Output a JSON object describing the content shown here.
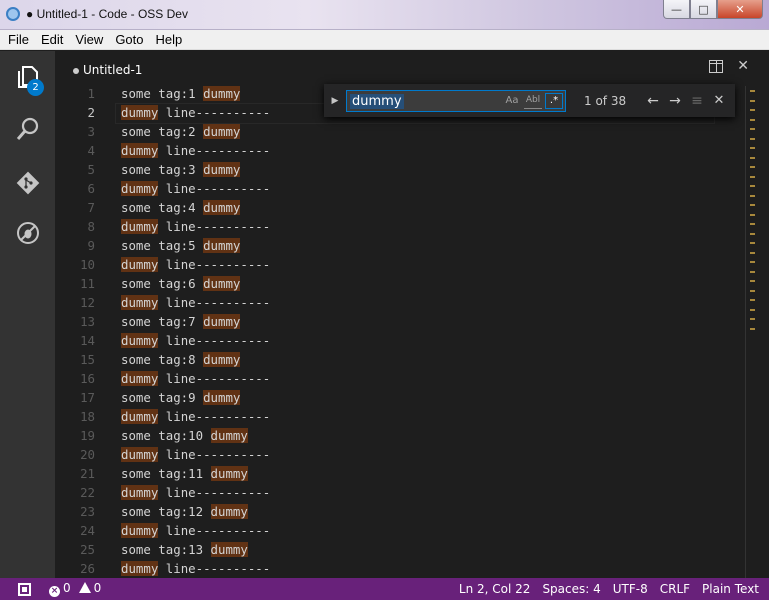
{
  "window": {
    "title": "● Untitled-1 - Code - OSS Dev"
  },
  "menu": [
    "File",
    "Edit",
    "View",
    "Goto",
    "Help"
  ],
  "activity": {
    "explorer_badge": "2"
  },
  "tab": {
    "title": "Untitled-1"
  },
  "find": {
    "query": "dummy",
    "match_case_label": "Aa",
    "whole_word_label": "Abl",
    "regex_label": ".*",
    "count": "1 of 38"
  },
  "lines": [
    {
      "n": "1",
      "pre": "some tag:1 ",
      "hl": "dummy",
      "post": ""
    },
    {
      "n": "2",
      "pre": "",
      "hl": "dummy",
      "post": " line----------"
    },
    {
      "n": "3",
      "pre": "some tag:2 ",
      "hl": "dummy",
      "post": ""
    },
    {
      "n": "4",
      "pre": "",
      "hl": "dummy",
      "post": " line----------"
    },
    {
      "n": "5",
      "pre": "some tag:3 ",
      "hl": "dummy",
      "post": ""
    },
    {
      "n": "6",
      "pre": "",
      "hl": "dummy",
      "post": " line----------"
    },
    {
      "n": "7",
      "pre": "some tag:4 ",
      "hl": "dummy",
      "post": ""
    },
    {
      "n": "8",
      "pre": "",
      "hl": "dummy",
      "post": " line----------"
    },
    {
      "n": "9",
      "pre": "some tag:5 ",
      "hl": "dummy",
      "post": ""
    },
    {
      "n": "10",
      "pre": "",
      "hl": "dummy",
      "post": " line----------"
    },
    {
      "n": "11",
      "pre": "some tag:6 ",
      "hl": "dummy",
      "post": ""
    },
    {
      "n": "12",
      "pre": "",
      "hl": "dummy",
      "post": " line----------"
    },
    {
      "n": "13",
      "pre": "some tag:7 ",
      "hl": "dummy",
      "post": ""
    },
    {
      "n": "14",
      "pre": "",
      "hl": "dummy",
      "post": " line----------"
    },
    {
      "n": "15",
      "pre": "some tag:8 ",
      "hl": "dummy",
      "post": ""
    },
    {
      "n": "16",
      "pre": "",
      "hl": "dummy",
      "post": " line----------"
    },
    {
      "n": "17",
      "pre": "some tag:9 ",
      "hl": "dummy",
      "post": ""
    },
    {
      "n": "18",
      "pre": "",
      "hl": "dummy",
      "post": " line----------"
    },
    {
      "n": "19",
      "pre": "some tag:10 ",
      "hl": "dummy",
      "post": ""
    },
    {
      "n": "20",
      "pre": "",
      "hl": "dummy",
      "post": " line----------"
    },
    {
      "n": "21",
      "pre": "some tag:11 ",
      "hl": "dummy",
      "post": ""
    },
    {
      "n": "22",
      "pre": "",
      "hl": "dummy",
      "post": " line----------"
    },
    {
      "n": "23",
      "pre": "some tag:12 ",
      "hl": "dummy",
      "post": ""
    },
    {
      "n": "24",
      "pre": "",
      "hl": "dummy",
      "post": " line----------"
    },
    {
      "n": "25",
      "pre": "some tag:13 ",
      "hl": "dummy",
      "post": ""
    },
    {
      "n": "26",
      "pre": "",
      "hl": "dummy",
      "post": " line----------"
    }
  ],
  "status": {
    "errors": "0",
    "warnings": "0",
    "position": "Ln 2, Col 22",
    "spaces": "Spaces: 4",
    "encoding": "UTF-8",
    "eol": "CRLF",
    "language": "Plain Text"
  },
  "colors": {
    "statusbar": "#68217a",
    "find_match": "#613214",
    "accent": "#007acc"
  }
}
